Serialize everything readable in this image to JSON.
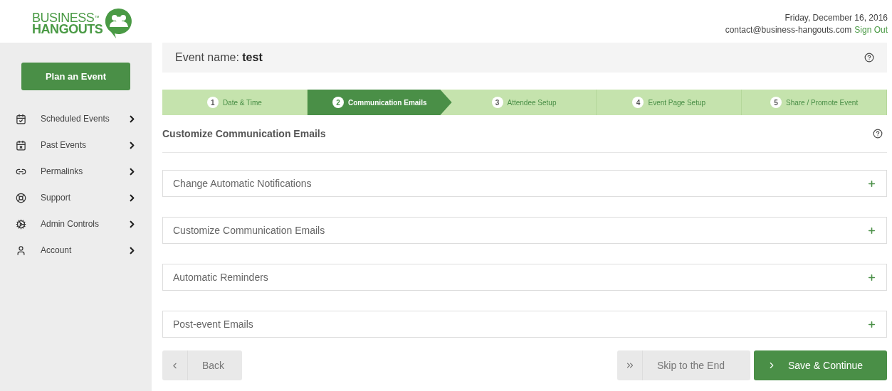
{
  "logo": {
    "line_1": "BUSINESS",
    "trademark": "™",
    "line_2": "HANGOUTS"
  },
  "header": {
    "date": "Friday, December 16, 2016",
    "email": "contact@business-hangouts.com",
    "sign_out": "Sign Out"
  },
  "sidebar": {
    "plan_button": "Plan an Event",
    "items": [
      {
        "label": "Scheduled Events"
      },
      {
        "label": "Past Events"
      },
      {
        "label": "Permalinks"
      },
      {
        "label": "Support"
      },
      {
        "label": "Admin Controls"
      },
      {
        "label": "Account"
      }
    ]
  },
  "event": {
    "label": "Event name:",
    "name": "test"
  },
  "steps": [
    {
      "number": "1",
      "label": "Date & Time",
      "selected": false
    },
    {
      "number": "2",
      "label": "Communication Emails",
      "selected": true
    },
    {
      "number": "3",
      "label": "Attendee Setup",
      "selected": false
    },
    {
      "number": "4",
      "label": "Event Page Setup",
      "selected": false
    },
    {
      "number": "5",
      "label": "Share / Promote Event",
      "selected": false
    }
  ],
  "section_title": "Customize Communication Emails",
  "panels": [
    {
      "title": "Change Automatic Notifications",
      "expanded": false
    },
    {
      "title": "Customize Communication Emails",
      "expanded": false
    },
    {
      "title": "Automatic Reminders",
      "expanded": false
    },
    {
      "title": "Post-event Emails",
      "expanded": false
    }
  ],
  "buttons": {
    "back": "Back",
    "skip": "Skip to the End",
    "save": "Save & Continue"
  }
}
